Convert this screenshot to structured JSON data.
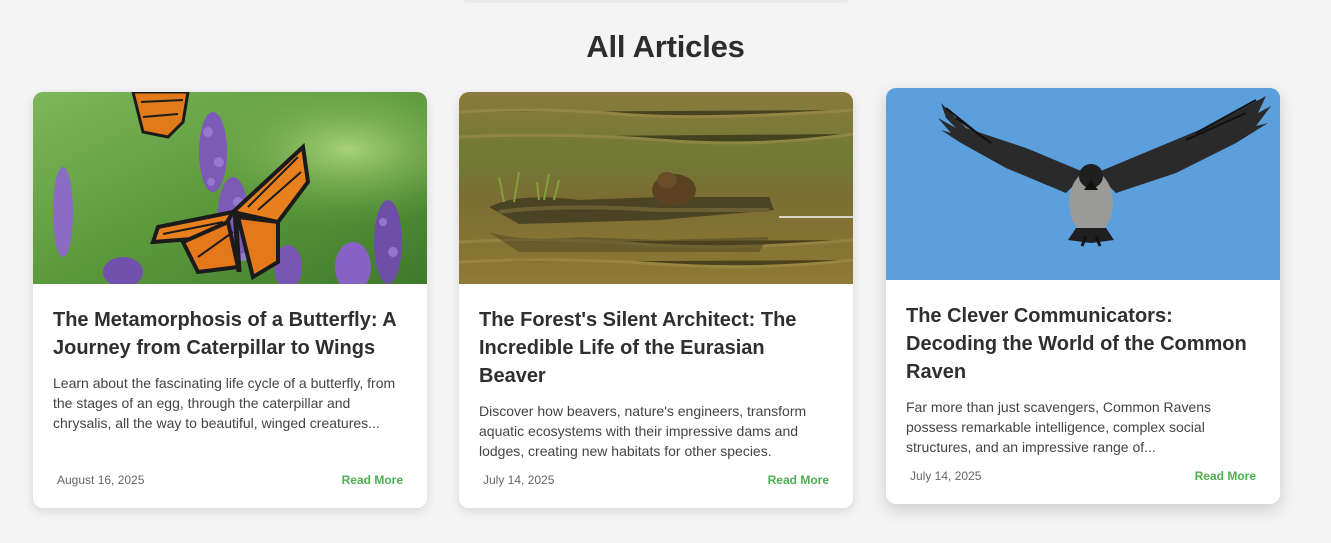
{
  "section": {
    "title": "All Articles"
  },
  "colors": {
    "accent": "#4caf50",
    "background": "#f4f4f4",
    "card": "#ffffff"
  },
  "articles": [
    {
      "title": "The Metamorphosis of a Butterfly: A Journey from Caterpillar to Wings",
      "excerpt": "Learn about the fascinating life cycle of a butterfly, from the stages of an egg, through the caterpillar and chrysalis, all the way to beautiful, winged creatures...",
      "date": "August 16, 2025",
      "link_label": "Read More",
      "image_name": "monarch-butterfly-image"
    },
    {
      "title": "The Forest's Silent Architect: The Incredible Life of the Eurasian Beaver",
      "excerpt": "Discover how beavers, nature's engineers, transform aquatic ecosystems with their impressive dams and lodges, creating new habitats for other species.",
      "date": "July 14, 2025",
      "link_label": "Read More",
      "image_name": "beaver-in-water-image"
    },
    {
      "title": "The Clever Communicators: Decoding the World of the Common Raven",
      "excerpt": "Far more than just scavengers, Common Ravens possess remarkable intelligence, complex social structures, and an impressive range of...",
      "date": "July 14, 2025",
      "link_label": "Read More",
      "image_name": "flying-crow-image"
    }
  ]
}
